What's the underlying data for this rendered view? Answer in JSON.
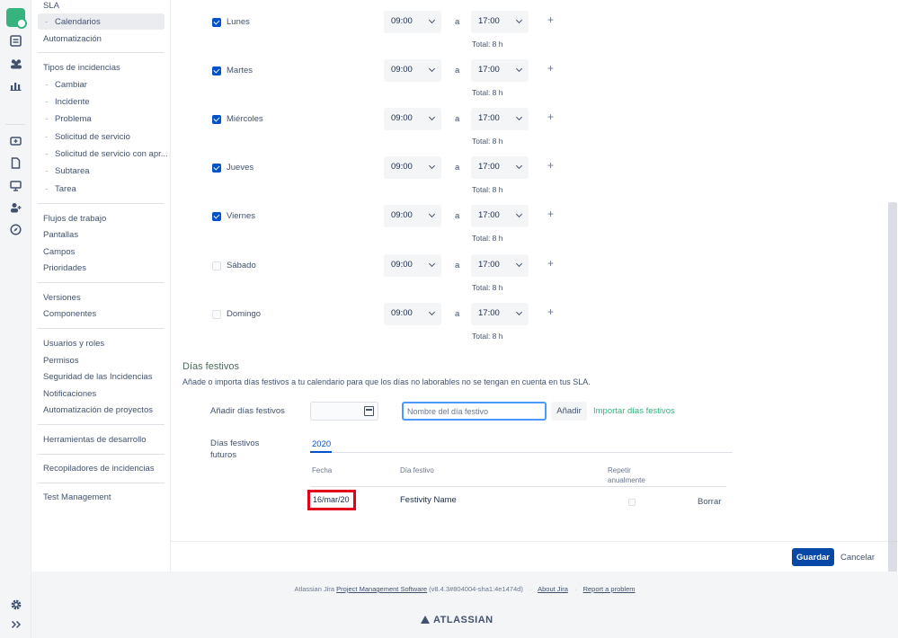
{
  "nav": {
    "sla": "SLA",
    "calendarios": "Calendarios",
    "automatizacion": "Automatización",
    "tipos": "Tipos de incidencias",
    "issue_types": [
      "Cambiar",
      "Incidente",
      "Problema",
      "Solicitud de servicio",
      "Solicitud de servicio con apr...",
      "Subtarea",
      "Tarea"
    ],
    "group2": [
      "Flujos de trabajo",
      "Pantallas",
      "Campos",
      "Prioridades"
    ],
    "group3": [
      "Versiones",
      "Componentes"
    ],
    "group4": [
      "Usuarios y roles",
      "Permisos",
      "Seguridad de las Incidencias",
      "Notificaciones",
      "Automatización de proyectos"
    ],
    "herramientas": "Herramientas de desarrollo",
    "recopiladores": "Recopiladores de incidencias",
    "test": "Test Management"
  },
  "schedule": {
    "separator": "a",
    "days": [
      {
        "name": "Lunes",
        "checked": true,
        "from": "09:00",
        "to": "17:00",
        "total": "Total: 8 h"
      },
      {
        "name": "Martes",
        "checked": true,
        "from": "09:00",
        "to": "17:00",
        "total": "Total: 8 h"
      },
      {
        "name": "Miércoles",
        "checked": true,
        "from": "09:00",
        "to": "17:00",
        "total": "Total: 8 h"
      },
      {
        "name": "Jueves",
        "checked": true,
        "from": "09:00",
        "to": "17:00",
        "total": "Total: 8 h"
      },
      {
        "name": "Viernes",
        "checked": true,
        "from": "09:00",
        "to": "17:00",
        "total": "Total: 8 h"
      },
      {
        "name": "Sábado",
        "checked": false,
        "from": "09:00",
        "to": "17:00",
        "total": "Total: 8 h"
      },
      {
        "name": "Domingo",
        "checked": false,
        "from": "09:00",
        "to": "17:00",
        "total": "Total: 8 h"
      }
    ]
  },
  "holidays": {
    "heading": "Días festivos",
    "description": "Añade o importa días festivos a tu calendario para que los días no laborables no se tengan en cuenta en tus SLA.",
    "add_label": "Añadir días festivos",
    "name_placeholder": "Nombre del día festivo",
    "add_button": "Añadir",
    "import_link": "Importar días festivos",
    "future_label": "Días festivos futuros",
    "year_tab": "2020",
    "col_date": "Fecha",
    "col_name": "Día festivo",
    "col_repeat": "Repetir anualmente",
    "rows": [
      {
        "date": "16/mar/20",
        "name": "Festivity Name",
        "repeat": false,
        "delete": "Borrar"
      }
    ]
  },
  "actions": {
    "save": "Guardar",
    "cancel": "Cancelar"
  },
  "footer": {
    "prefix": "Atlassian Jira",
    "pm_link": "Project Management Software",
    "version": "(v8.4.3#804004-sha1:4e1474d)",
    "about": "About Jira",
    "report": "Report a problem",
    "brand": "ATLASSIAN"
  }
}
